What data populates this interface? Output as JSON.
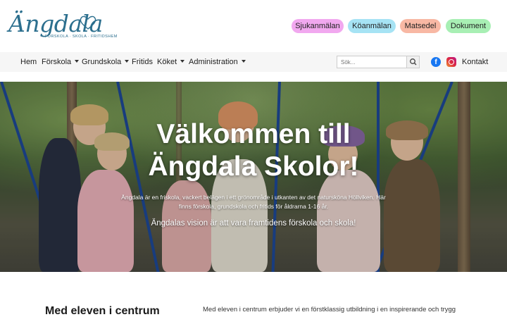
{
  "brand": {
    "logo_text": "Ängdala",
    "tagline": "FÖRSKOLA · SKOLA · FRITIDSHEM",
    "color": "#2c6f8e"
  },
  "quick_links": [
    {
      "label": "Sjukanmälan",
      "color": "#f1a8ef"
    },
    {
      "label": "Köanmälan",
      "color": "#a6e3f4"
    },
    {
      "label": "Matsedel",
      "color": "#f8b8a4"
    },
    {
      "label": "Dokument",
      "color": "#a8efb4"
    }
  ],
  "nav": {
    "items": [
      {
        "label": "Hem",
        "has_dropdown": false
      },
      {
        "label": "Förskola",
        "has_dropdown": true
      },
      {
        "label": "Grundskola",
        "has_dropdown": true
      },
      {
        "label": "Fritids",
        "has_dropdown": false
      },
      {
        "label": "Köket",
        "has_dropdown": true
      },
      {
        "label": "Administration",
        "has_dropdown": true
      }
    ],
    "search_placeholder": "Sök...",
    "search_icon": "search-icon",
    "social": [
      "facebook-icon",
      "instagram-icon"
    ],
    "contact_label": "Kontakt"
  },
  "hero": {
    "title": "Välkommen till Ängdala Skolor!",
    "text": "Ängdala är en friskola, vackert belägen i ett grönområde i utkanten av det natursköna Höllviken. Här finns förskola, grundskola och fritids för åldrarna 1-16 år.",
    "vision": "Ängdalas vision är att vara framtidens förskola och skola!"
  },
  "section": {
    "title": "Med eleven i centrum",
    "text": "Med eleven i centrum erbjuder vi en förstklassig utbildning i en inspirerande och trygg"
  }
}
